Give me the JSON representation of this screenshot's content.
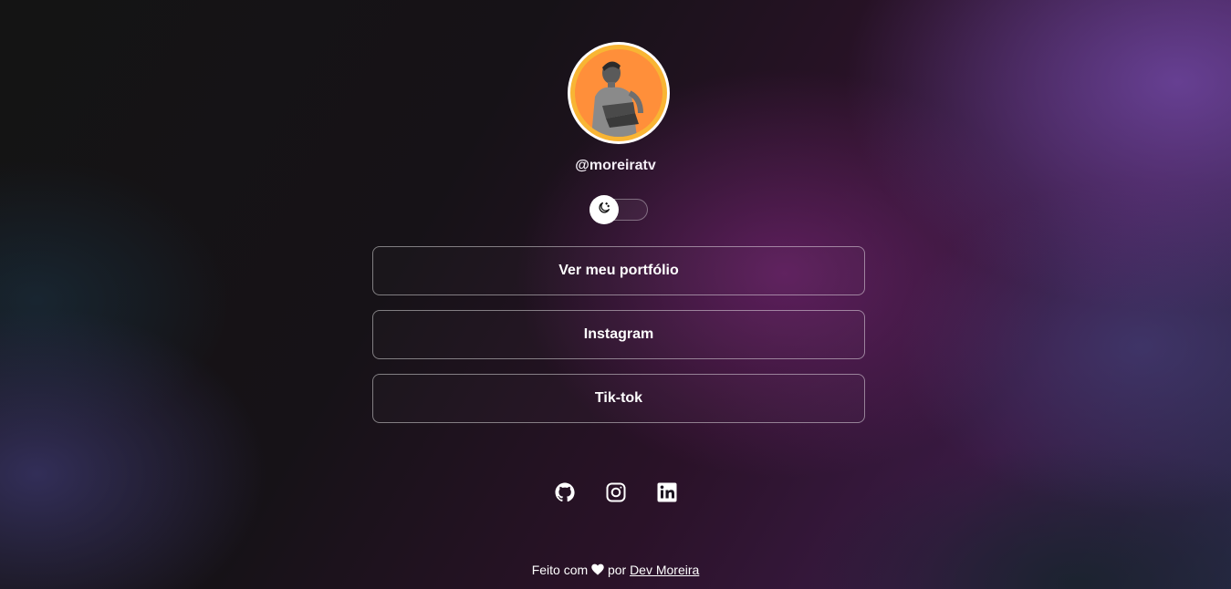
{
  "profile": {
    "username": "@moreiratv",
    "avatar_colors": {
      "ring": "#ffffff",
      "accent": "#f8b534",
      "fill": "#ff8f3a"
    }
  },
  "theme_toggle": {
    "icon": "moon-icon",
    "state": "dark"
  },
  "links": [
    {
      "label": "Ver meu portfólio"
    },
    {
      "label": "Instagram"
    },
    {
      "label": "Tik-tok"
    }
  ],
  "socials": [
    {
      "icon": "github-icon"
    },
    {
      "icon": "instagram-icon"
    },
    {
      "icon": "linkedin-icon"
    }
  ],
  "footer": {
    "prefix": "Feito com",
    "heart_icon": "heart-icon",
    "middle": "por",
    "author": "Dev Moreira"
  }
}
